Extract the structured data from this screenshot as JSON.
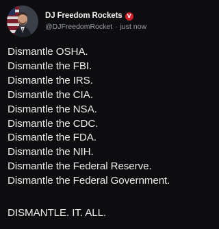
{
  "author": {
    "display_name": "DJ Freedom Rockets",
    "badge_text": "V",
    "badge_color": "#d21f2a",
    "handle": "@DJFreedomRocket",
    "separator": "·",
    "timestamp": "just now",
    "avatar_icon": "profile-photo"
  },
  "tweet": {
    "lines": [
      "Dismantle OSHA.",
      "Dismantle the FBI.",
      "Dismantle the IRS.",
      "Dismantle the CIA.",
      "Dismantle the NSA.",
      "Dismantle the CDC.",
      "Dismantle the FDA.",
      "Dismantle the NIH.",
      "Dismantle the Federal Reserve.",
      "Dismantle the Federal Government."
    ],
    "closing": "DISMANTLE. IT. ALL."
  }
}
